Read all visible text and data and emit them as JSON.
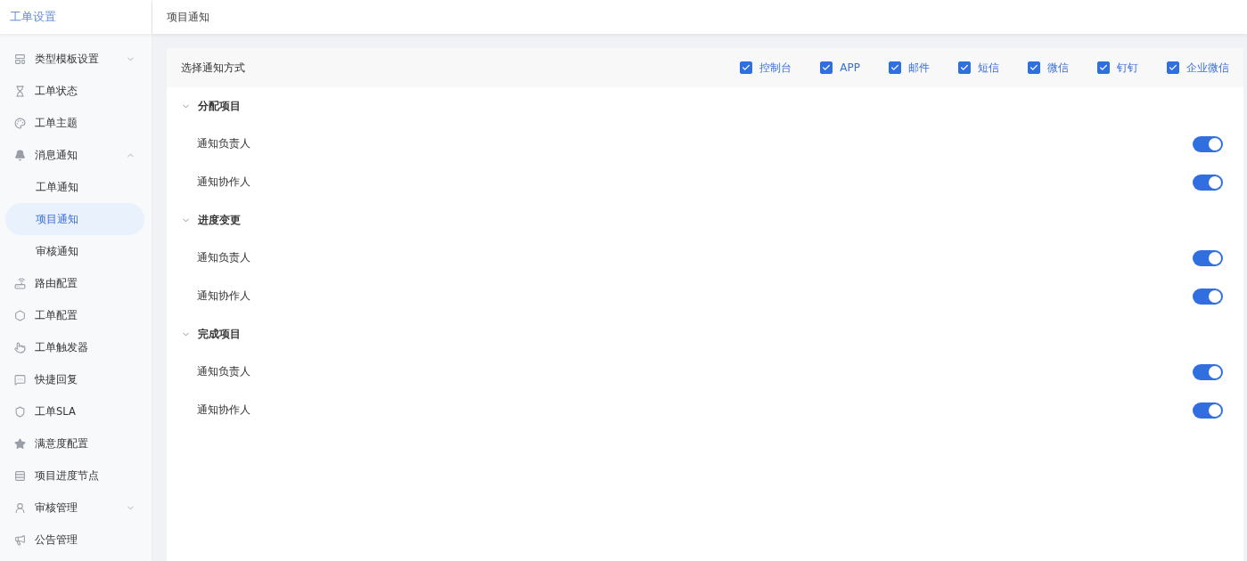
{
  "sidebar": {
    "title": "工单设置",
    "items": [
      {
        "label": "类型模板设置",
        "expanded": false
      },
      {
        "label": "工单状态"
      },
      {
        "label": "工单主题"
      },
      {
        "label": "消息通知",
        "expanded": true,
        "children": [
          {
            "label": "工单通知",
            "selected": false
          },
          {
            "label": "项目通知",
            "selected": true
          },
          {
            "label": "审核通知",
            "selected": false
          }
        ]
      },
      {
        "label": "路由配置"
      },
      {
        "label": "工单配置"
      },
      {
        "label": "工单触发器"
      },
      {
        "label": "快捷回复"
      },
      {
        "label": "工单SLA"
      },
      {
        "label": "满意度配置"
      },
      {
        "label": "项目进度节点"
      },
      {
        "label": "审核管理",
        "expanded": false
      },
      {
        "label": "公告管理"
      }
    ]
  },
  "header": {
    "title": "项目通知"
  },
  "channels": {
    "label": "选择通知方式",
    "options": [
      {
        "label": "控制台",
        "checked": true
      },
      {
        "label": "APP",
        "checked": true
      },
      {
        "label": "邮件",
        "checked": true
      },
      {
        "label": "短信",
        "checked": true
      },
      {
        "label": "微信",
        "checked": true
      },
      {
        "label": "钉钉",
        "checked": true
      },
      {
        "label": "企业微信",
        "checked": true
      }
    ]
  },
  "sections": [
    {
      "title": "分配项目",
      "expanded": true,
      "rows": [
        {
          "label": "通知负责人",
          "on": true
        },
        {
          "label": "通知协作人",
          "on": true
        }
      ]
    },
    {
      "title": "进度变更",
      "expanded": true,
      "rows": [
        {
          "label": "通知负责人",
          "on": true
        },
        {
          "label": "通知协作人",
          "on": true
        }
      ]
    },
    {
      "title": "完成项目",
      "expanded": true,
      "rows": [
        {
          "label": "通知负责人",
          "on": true
        },
        {
          "label": "通知协作人",
          "on": true
        }
      ]
    }
  ]
}
